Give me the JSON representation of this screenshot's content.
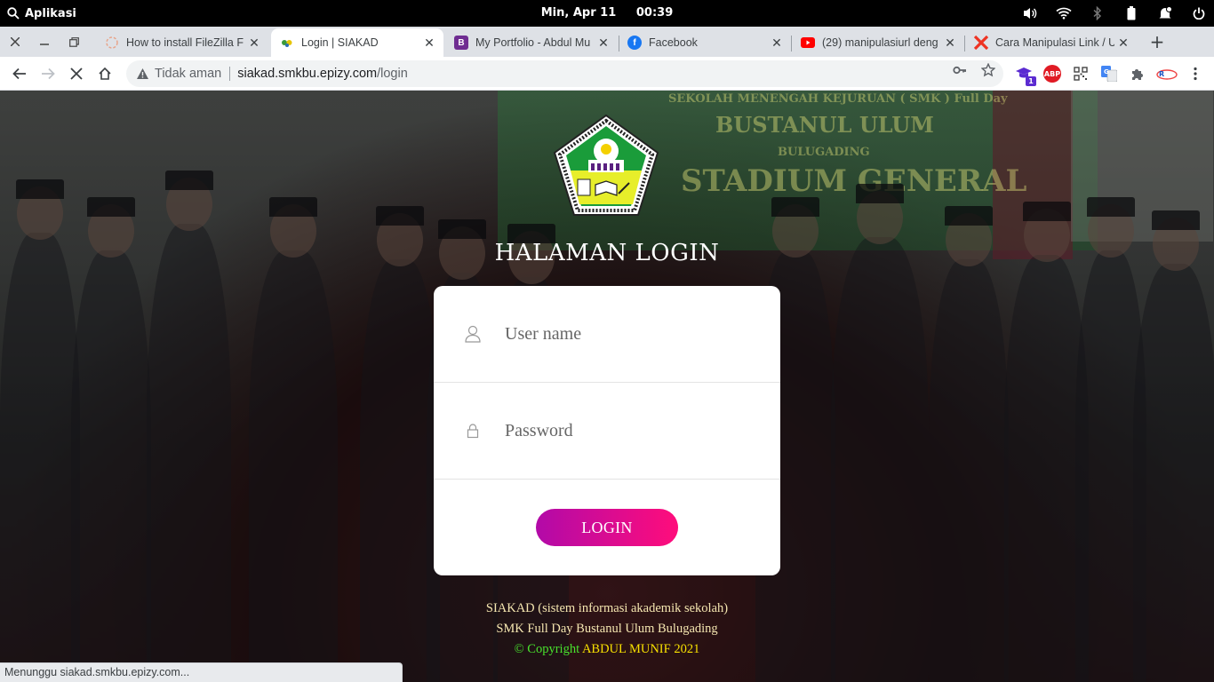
{
  "os": {
    "apps_label": "Aplikasi",
    "datetime": "Min, Apr 11     00:39"
  },
  "tabs": [
    {
      "title": "How to install FileZilla F",
      "favicon": "filezilla-loading-icon"
    },
    {
      "title": "Login | SIAKAD",
      "favicon": "siakad-icon",
      "active": true
    },
    {
      "title": "My Portfolio - Abdul Mu",
      "favicon": "bootstrap-icon"
    },
    {
      "title": "Facebook",
      "favicon": "facebook-icon"
    },
    {
      "title": "(29) manipulasiurl deng",
      "favicon": "youtube-icon"
    },
    {
      "title": "Cara Manipulasi Link / U",
      "favicon": "x-icon"
    }
  ],
  "toolbar": {
    "security_label": "Tidak aman",
    "url_host": "siakad.smkbu.epizy.com",
    "url_path": "/login",
    "extension_badge": "1",
    "abp_label": "ABP"
  },
  "background": {
    "banner_line1": "SEKOLAH MENENGAH KEJURUAN ( SMK ) Full Day",
    "banner_line2": "BUSTANUL ULUM",
    "banner_line3": "BULUGADING",
    "banner_line4": "STADIUM GENERAL"
  },
  "login": {
    "title": "HALAMAN LOGIN",
    "username_placeholder": "User name",
    "password_placeholder": "Password",
    "button_label": "LOGIN"
  },
  "footer": {
    "line1": "SIAKAD (sistem informasi akademik sekolah)",
    "line2": "SMK Full Day Bustanul Ulum Bulugading",
    "copyright_symbol": "© Copyright",
    "copyright_owner": "ABDUL MUNIF 2021"
  },
  "status": "Menunggu siakad.smkbu.epizy.com...",
  "colors": {
    "login_gradient_start": "#b20aa8",
    "login_gradient_end": "#ff0d7b",
    "footer_green": "#49e22d",
    "footer_yellow": "#f7e000"
  }
}
